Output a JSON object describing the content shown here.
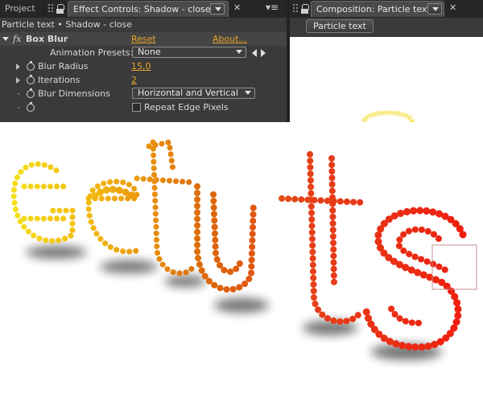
{
  "panels": {
    "project_tab": "Project",
    "effect_controls_tab": "Effect Controls: Shadow - close",
    "composition_tab": "Composition: Particle text"
  },
  "effect_controls": {
    "breadcrumb": "Particle text • Shadow - close",
    "effect_name": "Box Blur",
    "fx_label": "fx",
    "reset_label": "Reset",
    "about_label": "About...",
    "animation_presets_label": "Animation Presets:",
    "animation_presets_value": "None",
    "properties": [
      {
        "label": "Blur Radius",
        "value": "15,0"
      },
      {
        "label": "Iterations",
        "value": "2"
      },
      {
        "label": "Blur Dimensions",
        "value": "Horizontal and Vertical"
      }
    ],
    "repeat_edge_pixels_label": "Repeat Edge Pixels",
    "repeat_edge_pixels_checked": false
  },
  "composition": {
    "name_button": "Particle text"
  },
  "render": {
    "word": "tuts",
    "gradient_colors": [
      "#f6e61a",
      "#f2b00c",
      "#dc6a0a",
      "#e6401a",
      "#f01a0e"
    ],
    "shadow_color": "#000000"
  },
  "icons": [
    "lock-icon",
    "panel-menu-icon",
    "close-icon",
    "stopwatch-icon",
    "expand-triangle-icon",
    "checkbox-icon",
    "prev-preset-icon",
    "next-preset-icon"
  ]
}
